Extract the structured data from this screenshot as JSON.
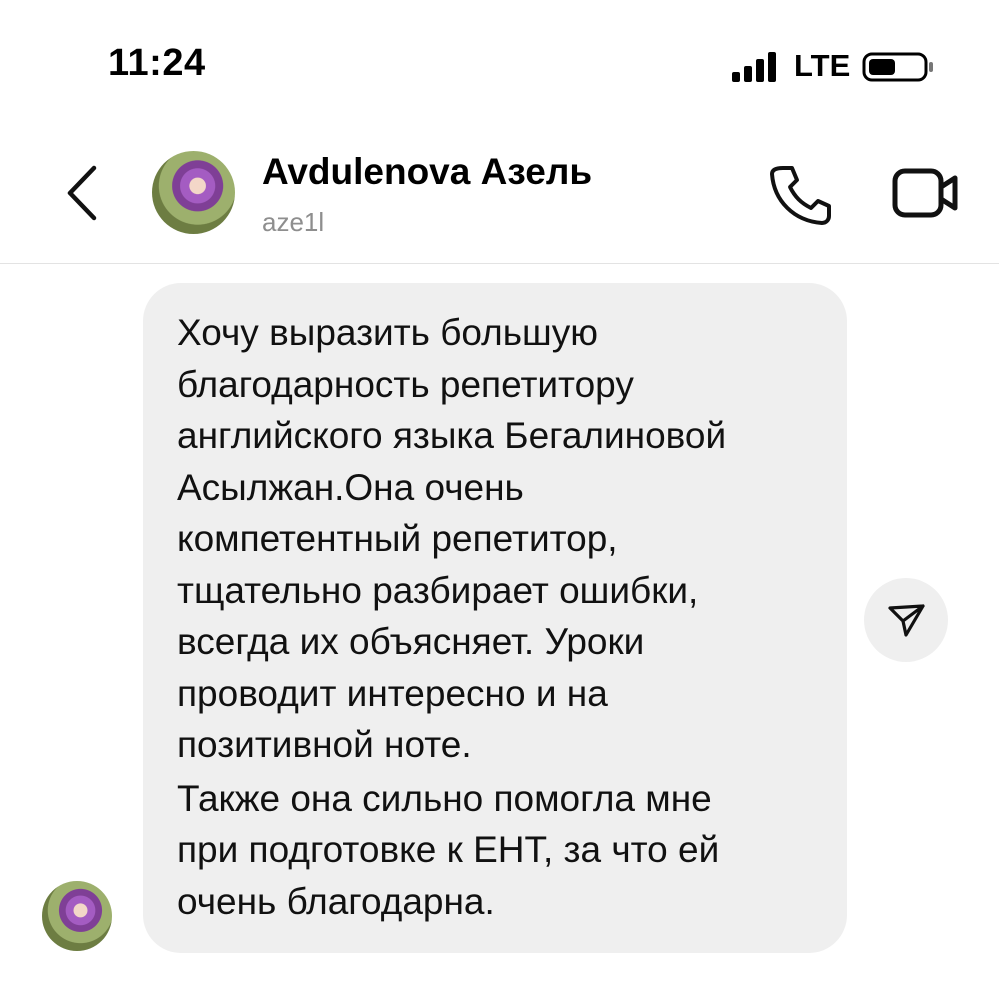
{
  "status_bar": {
    "time": "11:24",
    "network": "LTE",
    "icons": [
      "cellular-signal-icon",
      "battery-icon"
    ]
  },
  "header": {
    "contact_name": "Avdulenova Азель",
    "username": "aze1l",
    "icons": [
      "back-chevron-icon",
      "phone-icon",
      "video-camera-icon"
    ]
  },
  "message": {
    "lines": [
      "Хочу выразить большую",
      "благодарность репетитору",
      "английского языка Бегалиновой",
      "Асылжан.Она очень",
      "компетентный репетитор,",
      "тщательно разбирает ошибки,",
      "всегда их объясняет. Уроки",
      "проводит интересно и на",
      "позитивной ноте.",
      "Также она  сильно помогла мне",
      "при подготовке к ЕНТ, за что ей",
      "очень благодарна."
    ]
  },
  "colors": {
    "bubble": "#efefef",
    "username": "#8e8e8e",
    "divider": "#e3e3e3"
  }
}
